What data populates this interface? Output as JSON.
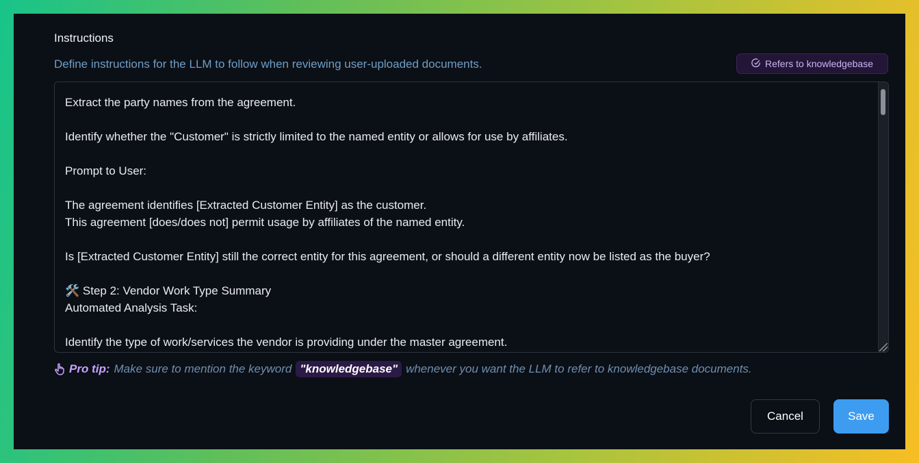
{
  "dialog": {
    "title": "Instructions",
    "subtitle": "Define instructions for the LLM to follow when reviewing user-uploaded documents.",
    "badge": {
      "label": "Refers to knowledgebase",
      "icon": "check-circle-icon"
    }
  },
  "editor": {
    "lines": [
      "Extract the party names from the agreement.",
      "",
      "Identify whether the \"Customer\" is strictly limited to the named entity or allows for use by affiliates.",
      "",
      "Prompt to User:",
      "",
      "The agreement identifies [Extracted Customer Entity] as the customer.",
      "This agreement [does/does not] permit usage by affiliates of the named entity.",
      "",
      "Is [Extracted Customer Entity] still the correct entity for this agreement, or should a different entity now be listed as the buyer?",
      "",
      "🛠️ Step 2: Vendor Work Type Summary",
      "Automated Analysis Task:",
      "",
      "Identify the type of work/services the vendor is providing under the master agreement."
    ]
  },
  "tip": {
    "icon": "hand-pointer-icon",
    "label": "Pro tip:",
    "text_before": "Make sure to mention the keyword",
    "keyword": "\"knowledgebase\"",
    "text_after": "whenever you want the LLM to refer to knowledgebase documents."
  },
  "actions": {
    "cancel_label": "Cancel",
    "save_label": "Save"
  },
  "colors": {
    "accent": "#3d9cf0",
    "badge_text": "#c9b4f5",
    "subtitle": "#6f9fc6",
    "panel_bg": "#0b0f16"
  }
}
